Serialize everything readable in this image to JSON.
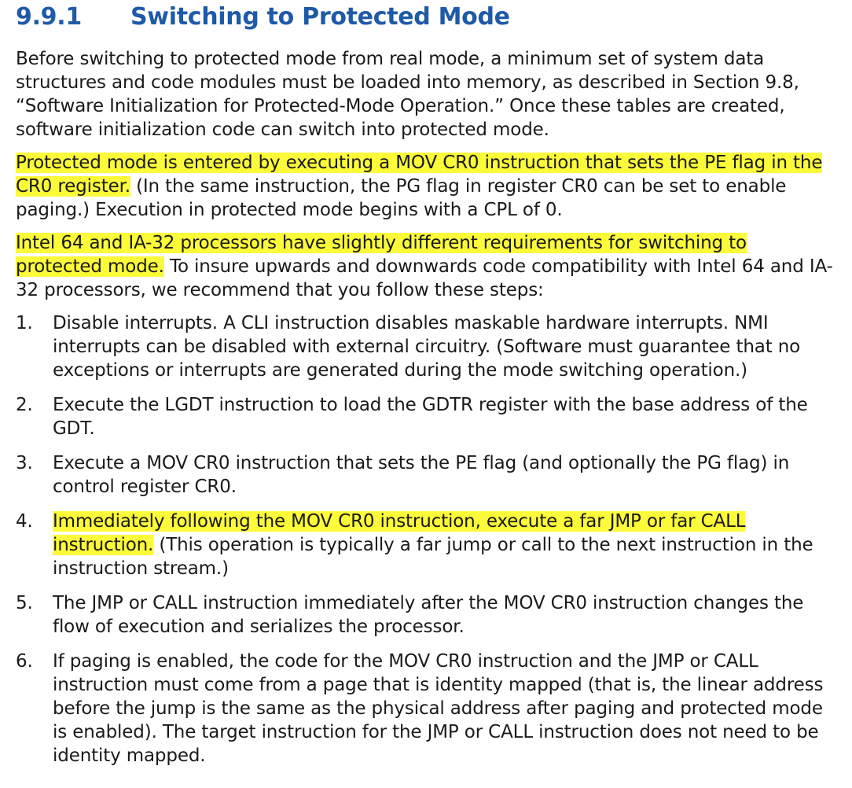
{
  "section": {
    "number": "9.9.1",
    "title": "Switching to Protected Mode"
  },
  "paragraphs": [
    {
      "highlight": "",
      "text": "Before switching to protected mode from real mode, a minimum set of system data structures and code modules must be loaded into memory, as described in Section 9.8, “Software Initialization for Protected-Mode Operation.” Once these tables are created, software initialization code can switch into protected mode."
    },
    {
      "highlight": "Protected mode is entered by executing a MOV CR0 instruction that sets the PE flag in the CR0 register.",
      "text": " (In the same instruction, the PG flag in register CR0 can be set to enable paging.) Execution in protected mode begins with a CPL of 0."
    },
    {
      "highlight": "Intel 64 and IA-32 processors have slightly different requirements for switching to protected mode.",
      "text": " To insure upwards and downwards code compatibility with Intel 64 and IA-32 processors, we recommend that you follow these steps:"
    }
  ],
  "steps": [
    {
      "number": "1.",
      "highlight": "",
      "text": "Disable interrupts. A CLI instruction disables maskable hardware interrupts. NMI interrupts can be disabled with external circuitry. (Software must guarantee that no exceptions or interrupts are generated during the mode switching operation.)"
    },
    {
      "number": "2.",
      "highlight": "",
      "text": "Execute the LGDT instruction to load the GDTR register with the base address of the GDT."
    },
    {
      "number": "3.",
      "highlight": "",
      "text": "Execute a MOV CR0 instruction that sets the PE flag (and optionally the PG flag) in control register CR0."
    },
    {
      "number": "4.",
      "highlight": "Immediately following the MOV CR0 instruction, execute a far JMP or far CALL instruction.",
      "text": " (This operation is typically a far jump or call to the next instruction in the instruction stream.)"
    },
    {
      "number": "5.",
      "highlight": "",
      "text": "The JMP or CALL instruction immediately after the MOV CR0 instruction changes the flow of execution and serializes the processor."
    },
    {
      "number": "6.",
      "highlight": "",
      "text": "If paging is enabled, the code for the MOV CR0 instruction and the JMP or CALL instruction must come from a page that is identity mapped (that is, the linear address before the jump is the same as the physical address after paging and protected mode is enabled). The target instruction for the JMP or CALL instruction does not need to be identity mapped."
    }
  ],
  "colors": {
    "heading": "#1f5aa8",
    "highlight": "#fbfb3a",
    "text": "#1a1a1a"
  }
}
